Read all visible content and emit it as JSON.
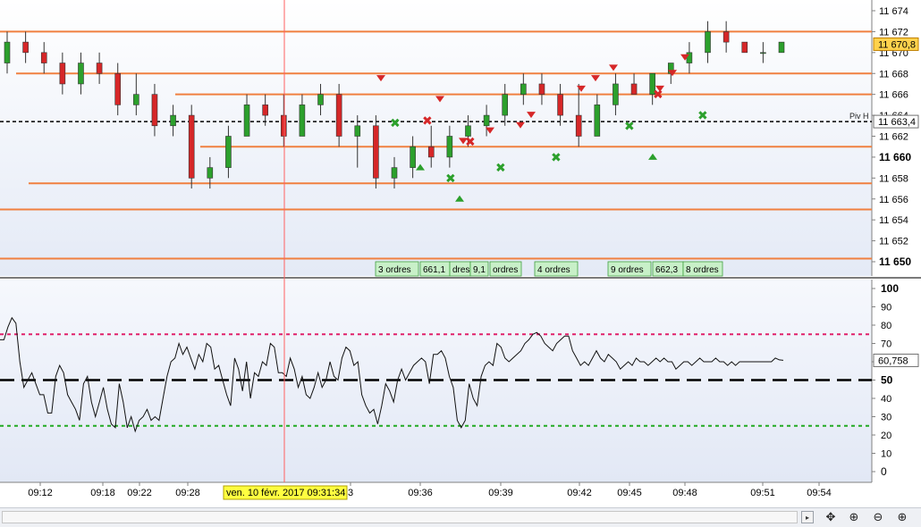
{
  "price_panel": {
    "y_ticks": [
      "11 674",
      "11 672",
      "11 670",
      "11 668",
      "11 666",
      "11 664",
      "11 662",
      "11 660",
      "11 658",
      "11 656",
      "11 654",
      "11 652",
      "11 650"
    ],
    "y_ticks_bold": [
      "11 660",
      "11 650"
    ],
    "current_price_label": "11 670,8",
    "pivot_label": "11 663,4",
    "pivot_name": "Piv H",
    "order_labels": [
      "3 ordres",
      "661,1",
      "dres",
      "9,1",
      "ordres",
      "4 ordres",
      "9 ordres",
      "662,3",
      "8 ordres"
    ]
  },
  "rsi_panel": {
    "y_ticks": [
      "100",
      "90",
      "80",
      "70",
      "60",
      "50",
      "40",
      "30",
      "20",
      "10",
      "0"
    ],
    "current_label": "60,758"
  },
  "x_axis": {
    "ticks": [
      "09:12",
      "09:18",
      "09:22",
      "09:28",
      "3",
      "09:36",
      "09:39",
      "09:42",
      "09:45",
      "09:48",
      "09:51",
      "09:54"
    ],
    "cursor_label": "ven. 10 févr. 2017 09:31:34"
  },
  "toolbar": {
    "scroll_right": "▸",
    "scroll_end": "▸|",
    "move_icon": "✥",
    "zoom_fit_icon": "⊕",
    "zoom_out_icon": "⊖",
    "zoom_in_icon": "⊕"
  },
  "colors": {
    "bull": "#2ca02c",
    "bear": "#d62728",
    "level_line": "#f08040",
    "pivot_line": "#000000",
    "cursor_line": "#ff6060",
    "rsi_high": "#e0206a",
    "rsi_low": "#22aa22",
    "label_bg": "#ffff40",
    "price_tag_bg": "#ffd24d"
  },
  "chart_data": [
    {
      "type": "candlestick",
      "title": "",
      "ylim": [
        11649,
        11675
      ],
      "x": [
        "09:10",
        "09:11",
        "09:12",
        "09:13",
        "09:14",
        "09:15",
        "09:16",
        "09:17",
        "09:18",
        "09:19",
        "09:20",
        "09:21",
        "09:22",
        "09:23",
        "09:24",
        "09:25",
        "09:26",
        "09:27",
        "09:28",
        "09:29",
        "09:30",
        "09:31",
        "09:32",
        "09:33",
        "09:34",
        "09:35",
        "09:36",
        "09:37",
        "09:38",
        "09:39",
        "09:40",
        "09:41",
        "09:42",
        "09:43",
        "09:44",
        "09:45",
        "09:46",
        "09:47",
        "09:48",
        "09:49",
        "09:50",
        "09:51",
        "09:52"
      ],
      "ohlc": [
        [
          11669,
          11672,
          11668,
          11671
        ],
        [
          11671,
          11672,
          11669,
          11670
        ],
        [
          11670,
          11671,
          11668,
          11669
        ],
        [
          11669,
          11670,
          11666,
          11667
        ],
        [
          11667,
          11670,
          11666,
          11669
        ],
        [
          11669,
          11670,
          11667,
          11668
        ],
        [
          11668,
          11669,
          11664,
          11665
        ],
        [
          11665,
          11668,
          11664,
          11666
        ],
        [
          11666,
          11667,
          11662,
          11663
        ],
        [
          11663,
          11665,
          11662,
          11664
        ],
        [
          11664,
          11665,
          11657,
          11658
        ],
        [
          11658,
          11660,
          11657,
          11659
        ],
        [
          11659,
          11663,
          11658,
          11662
        ],
        [
          11662,
          11666,
          11662,
          11665
        ],
        [
          11665,
          11666,
          11663,
          11664
        ],
        [
          11664,
          11666,
          11661,
          11662
        ],
        [
          11662,
          11666,
          11662,
          11665
        ],
        [
          11665,
          11667,
          11664,
          11666
        ],
        [
          11666,
          11667,
          11661,
          11662
        ],
        [
          11662,
          11664,
          11659,
          11663
        ],
        [
          11663,
          11664,
          11657,
          11658
        ],
        [
          11658,
          11660,
          11657,
          11659
        ],
        [
          11659,
          11662,
          11658,
          11661
        ],
        [
          11661,
          11663,
          11659,
          11660
        ],
        [
          11660,
          11663,
          11659,
          11662
        ],
        [
          11662,
          11664,
          11661,
          11663
        ],
        [
          11663,
          11665,
          11662,
          11664
        ],
        [
          11664,
          11667,
          11663,
          11666
        ],
        [
          11666,
          11668,
          11665,
          11667
        ],
        [
          11667,
          11668,
          11665,
          11666
        ],
        [
          11666,
          11667,
          11663,
          11664
        ],
        [
          11664,
          11667,
          11661,
          11662
        ],
        [
          11662,
          11666,
          11662,
          11665
        ],
        [
          11665,
          11668,
          11664,
          11667
        ],
        [
          11667,
          11668,
          11666,
          11666
        ],
        [
          11666,
          11668,
          11665,
          11668
        ],
        [
          11668,
          11669,
          11667,
          11669
        ],
        [
          11669,
          11671,
          11668,
          11670
        ],
        [
          11670,
          11673,
          11669,
          11672
        ],
        [
          11672,
          11673,
          11670,
          11671
        ],
        [
          11671,
          11671,
          11670,
          11670
        ],
        [
          11670,
          11671,
          11669,
          11670
        ],
        [
          11670,
          11671,
          11670,
          11671
        ]
      ],
      "level_lines": [
        11672,
        11668,
        11666,
        11661,
        11657.5,
        11655,
        11650.3
      ],
      "pivot": 11663.4,
      "last": 11670.8
    },
    {
      "type": "line",
      "title": "",
      "ylim": [
        0,
        100
      ],
      "levels": [
        75,
        50,
        25
      ],
      "values": [
        72,
        72,
        79,
        84,
        81,
        60,
        46,
        50,
        54,
        48,
        42,
        42,
        32,
        32,
        52,
        58,
        54,
        42,
        38,
        34,
        28,
        48,
        52,
        38,
        30,
        38,
        46,
        34,
        26,
        24,
        48,
        38,
        24,
        30,
        22,
        28,
        30,
        34,
        28,
        30,
        28,
        40,
        52,
        60,
        62,
        70,
        64,
        68,
        62,
        56,
        64,
        60,
        70,
        68,
        56,
        58,
        50,
        42,
        36,
        62,
        56,
        44,
        60,
        40,
        54,
        52,
        60,
        58,
        70,
        68,
        54,
        54,
        52,
        62,
        56,
        46,
        52,
        42,
        40,
        46,
        54,
        46,
        50,
        60,
        52,
        50,
        62,
        68,
        66,
        58,
        60,
        42,
        36,
        32,
        34,
        26,
        36,
        48,
        44,
        38,
        50,
        56,
        50,
        54,
        58,
        60,
        62,
        60,
        48,
        64,
        64,
        66,
        62,
        52,
        46,
        28,
        24,
        28,
        48,
        40,
        36,
        52,
        58,
        60,
        58,
        70,
        68,
        62,
        60,
        62,
        64,
        66,
        70,
        72,
        75,
        76,
        74,
        70,
        68,
        66,
        70,
        72,
        74,
        74,
        66,
        62,
        58,
        60,
        58,
        62,
        66,
        62,
        60,
        64,
        62,
        60,
        56,
        58,
        60,
        58,
        62,
        60,
        60,
        58,
        60,
        62,
        60,
        62,
        60,
        60,
        56,
        58,
        60,
        60,
        58,
        60,
        62,
        60,
        60,
        60,
        62,
        60,
        60,
        58,
        60,
        58,
        60,
        60,
        60,
        60,
        60,
        60,
        60,
        60,
        60,
        62,
        61,
        60.758
      ]
    }
  ]
}
